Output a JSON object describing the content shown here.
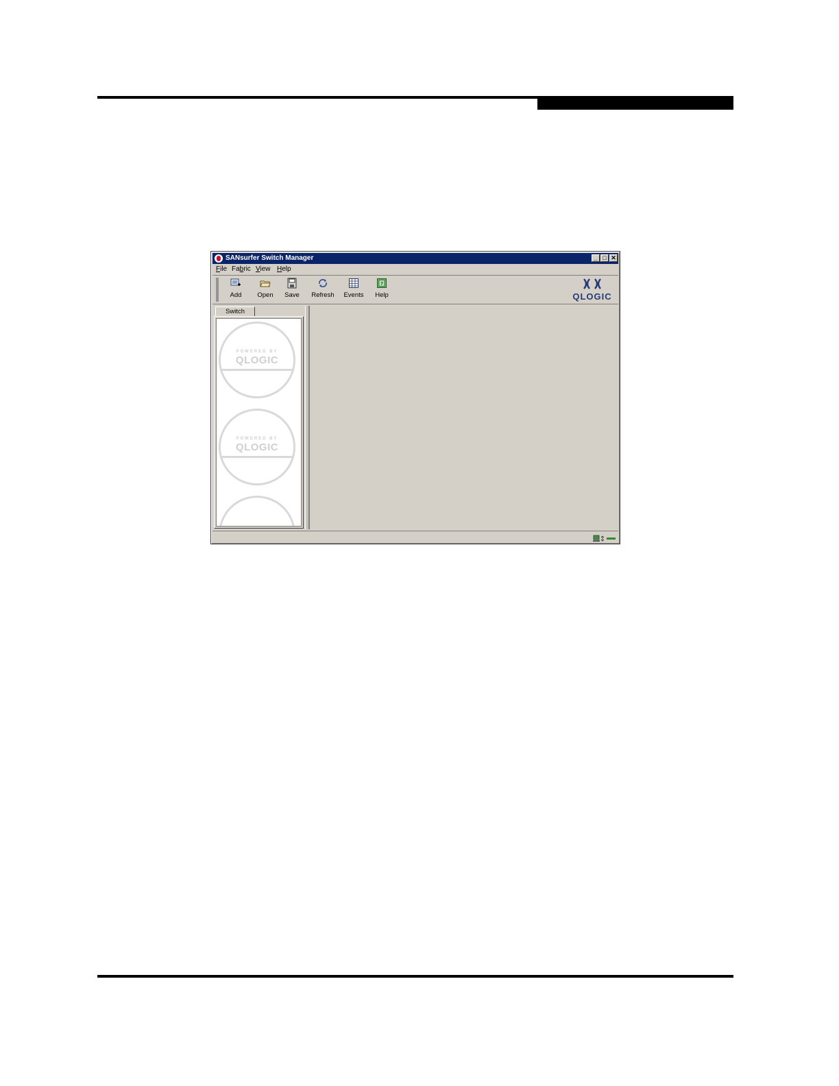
{
  "window": {
    "title": "SANsurfer Switch Manager"
  },
  "window_controls": {
    "minimize": "_",
    "maximize": "□",
    "close": "✕"
  },
  "menu": [
    {
      "label": "File",
      "mnemonic": "F",
      "rest": "ile"
    },
    {
      "label": "Fabric",
      "pre": "Fa",
      "mnemonic": "b",
      "rest": "ric"
    },
    {
      "label": "View",
      "mnemonic": "V",
      "rest": "iew"
    },
    {
      "label": "Help",
      "mnemonic": "H",
      "rest": "elp"
    }
  ],
  "toolbar": {
    "add": "Add",
    "open": "Open",
    "save": "Save",
    "refresh": "Refresh",
    "events": "Events",
    "help": "Help"
  },
  "logo": {
    "word": "QLOGIC"
  },
  "left_panel": {
    "tab_label": "Switch",
    "badge_top_text": "POWERED BY",
    "badge_brand_text": "QLOGIC"
  },
  "colors": {
    "titlebar": "#0a246a",
    "window_bg": "#d4d0c8",
    "logo_blue": "#233a7a",
    "status_green": "#2e8b2e"
  },
  "icons": {
    "app": "sansurfer-app-icon",
    "add": "add-switch-icon",
    "open": "open-folder-icon",
    "save": "save-disk-icon",
    "refresh": "refresh-icon",
    "events": "events-grid-icon",
    "help": "help-book-icon",
    "status": "network-connection-icon"
  }
}
